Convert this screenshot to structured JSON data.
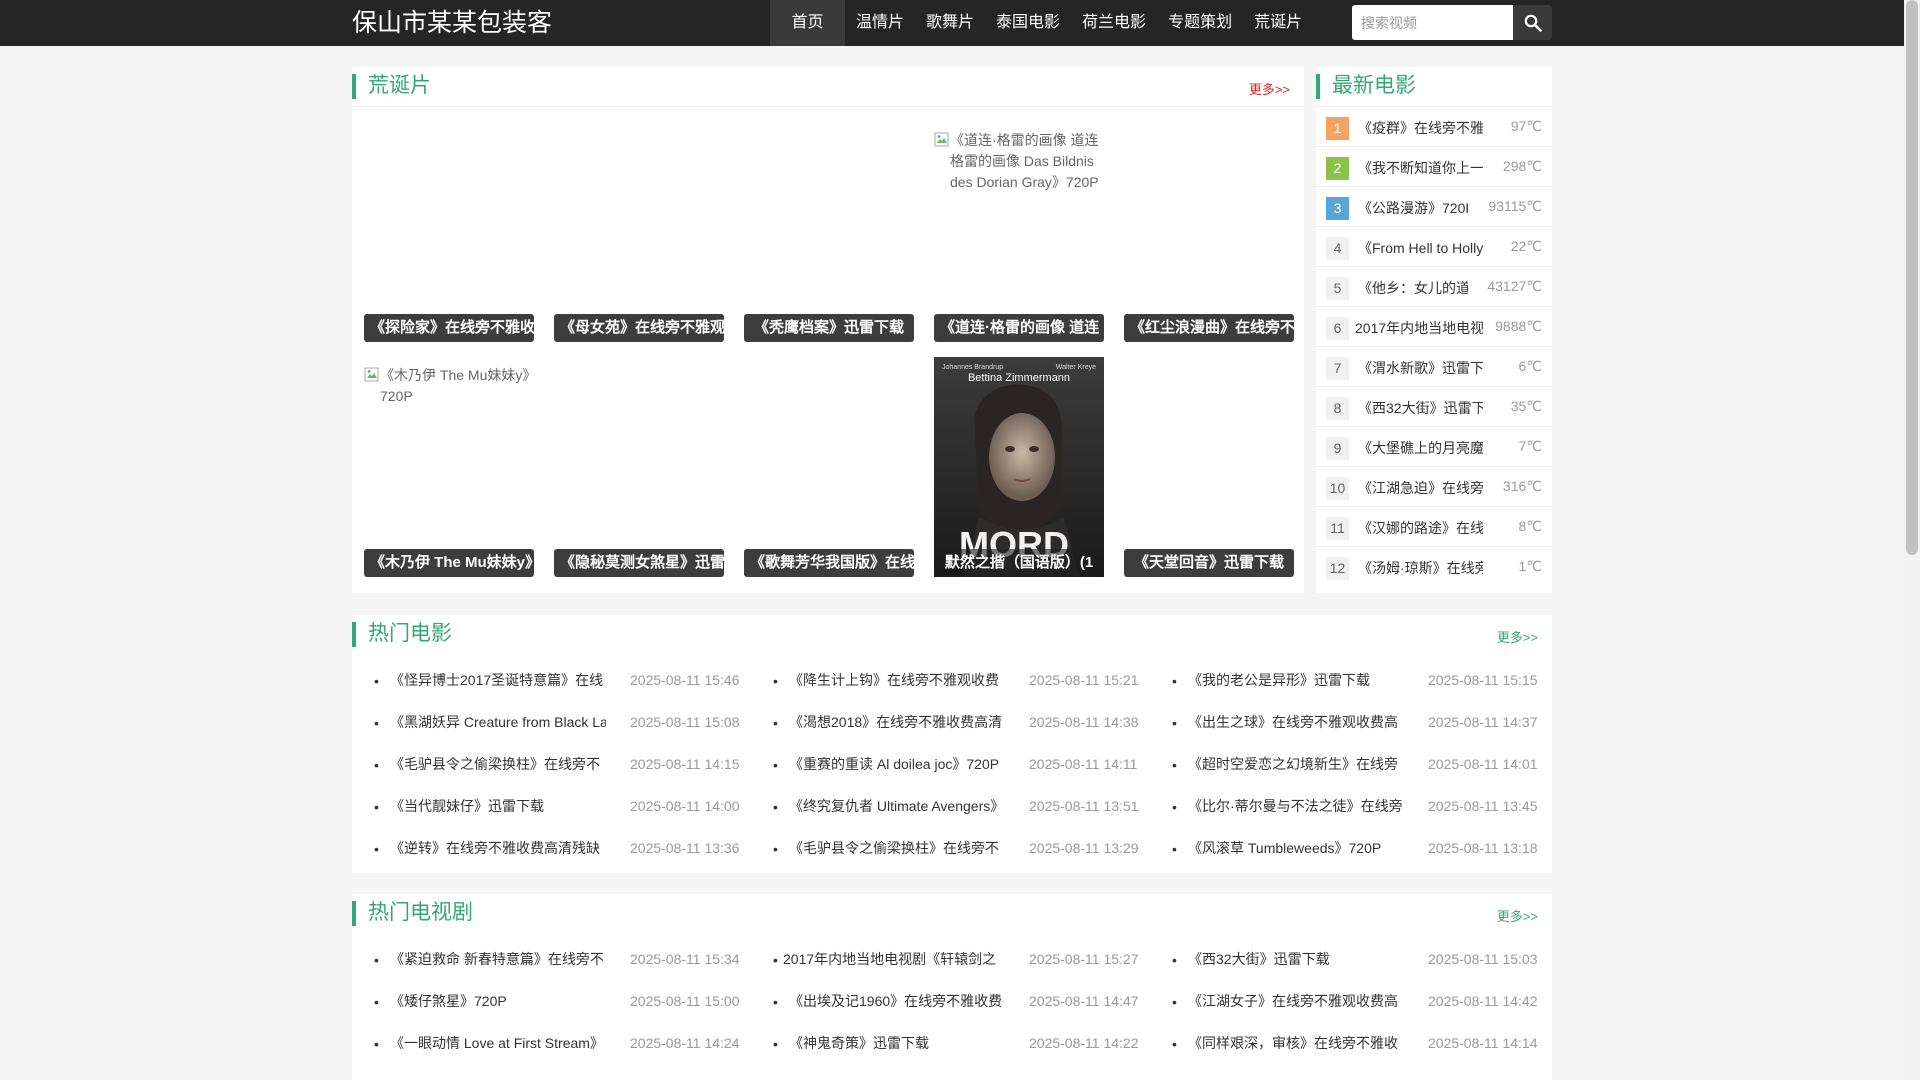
{
  "site": {
    "title": "保山市某某包装客"
  },
  "nav": {
    "items": [
      "首页",
      "温情片",
      "歌舞片",
      "泰国电影",
      "荷兰电影",
      "专题策划",
      "荒诞片"
    ]
  },
  "search": {
    "placeholder": "搜索视频",
    "icon": "search-icon"
  },
  "absurd": {
    "title": "荒诞片",
    "more": "更多>>",
    "posters": [
      {
        "caption": "《探险家》在线旁不雅收",
        "alt": ""
      },
      {
        "caption": "《母女苑》在线旁不雅观",
        "alt": ""
      },
      {
        "caption": "《秃鹰档案》迅雷下载",
        "alt": ""
      },
      {
        "caption": "《道连·格雷的画像 道连",
        "alt": "《道连·格雷的画像 道连格雷的画像 Das Bildnis des Dorian Gray》720P"
      },
      {
        "caption": "《红尘浪漫曲》在线旁不",
        "alt": ""
      },
      {
        "caption": "《木乃伊 The Mu妹妹y》",
        "alt": "《木乃伊 The Mu妹妹y》720P"
      },
      {
        "caption": "《隐秘莫测女煞星》迅雷",
        "alt": ""
      },
      {
        "caption": "《歌舞芳华我国版》在线",
        "alt": ""
      },
      {
        "caption": "默然之揩（国语版）(1",
        "alt": "",
        "cover": {
          "top_left": "Johannes Brandrup",
          "name": "Bettina Zimmermann",
          "top_right": "Walter Kreye",
          "word": "MORD"
        }
      },
      {
        "caption": "《天堂回音》迅雷下载",
        "alt": ""
      }
    ]
  },
  "latest": {
    "title": "最新电影",
    "items": [
      {
        "num": "1",
        "title": "《疫群》在线旁不雅",
        "temp": "97℃"
      },
      {
        "num": "2",
        "title": "《我不断知道你上一",
        "temp": "298℃"
      },
      {
        "num": "3",
        "title": "《公路漫游》720P",
        "temp": "93115℃"
      },
      {
        "num": "4",
        "title": "《From Hell to Holly",
        "temp": "22℃"
      },
      {
        "num": "5",
        "title": "《他乡：女儿的道",
        "temp": "43127℃"
      },
      {
        "num": "6",
        "title": "2017年内地当地电视",
        "temp": "9888℃"
      },
      {
        "num": "7",
        "title": "《渭水新歌》迅雷下",
        "temp": "6℃"
      },
      {
        "num": "8",
        "title": "《西32大街》迅雷下",
        "temp": "35℃"
      },
      {
        "num": "9",
        "title": "《大堡礁上的月亮魔",
        "temp": "7℃"
      },
      {
        "num": "10",
        "title": "《江湖急迫》在线旁",
        "temp": "316℃"
      },
      {
        "num": "11",
        "title": "《汉娜的路途》在线",
        "temp": "8℃"
      },
      {
        "num": "12",
        "title": "《汤姆·琼斯》在线旁",
        "temp": "1℃"
      }
    ]
  },
  "hot_movies": {
    "title": "热门电影",
    "more": "更多>>",
    "columns": [
      [
        {
          "title": "《怪异博士2017圣诞特意篇》在线",
          "date": "2025-08-11 15:46"
        },
        {
          "title": "《黑湖妖异 Creature from Black La",
          "date": "2025-08-11 15:08"
        },
        {
          "title": "《毛驴县令之偷梁换柱》在线旁不",
          "date": "2025-08-11 14:15"
        },
        {
          "title": "《当代靓妹仔》迅雷下载",
          "date": "2025-08-11 14:00"
        },
        {
          "title": "《逆转》在线旁不雅收费高清残缺",
          "date": "2025-08-11 13:36"
        }
      ],
      [
        {
          "title": "《降生计上钩》在线旁不雅观收费",
          "date": "2025-08-11 15:21"
        },
        {
          "title": "《渴想2018》在线旁不雅收费高清",
          "date": "2025-08-11 14:38"
        },
        {
          "title": "《重赛的重读 Al doilea joc》720P",
          "date": "2025-08-11 14:11"
        },
        {
          "title": "《终究复仇者 Ultimate Avengers》",
          "date": "2025-08-11 13:51"
        },
        {
          "title": "《毛驴县令之偷梁换柱》在线旁不",
          "date": "2025-08-11 13:29"
        }
      ],
      [
        {
          "title": "《我的老公是异形》迅雷下载",
          "date": "2025-08-11 15:15"
        },
        {
          "title": "《出生之球》在线旁不雅观收费高",
          "date": "2025-08-11 14:37"
        },
        {
          "title": "《超时空爱恋之幻境新生》在线旁",
          "date": "2025-08-11 14:01"
        },
        {
          "title": "《比尔·蒂尔曼与不法之徒》在线旁",
          "date": "2025-08-11 13:45"
        },
        {
          "title": "《风滚草 Tumbleweeds》720P",
          "date": "2025-08-11 13:18"
        }
      ]
    ]
  },
  "hot_tv": {
    "title": "热门电视剧",
    "more": "更多>>",
    "columns": [
      [
        {
          "title": "《紧迫救命 新春特意篇》在线旁不",
          "date": "2025-08-11 15:34"
        },
        {
          "title": "《矮仔煞星》720P",
          "date": "2025-08-11 15:00"
        },
        {
          "title": "《一眼动情 Love at First Stream》",
          "date": "2025-08-11 14:24"
        }
      ],
      [
        {
          "title": "2017年内地当地电视剧《轩辕剑之",
          "date": "2025-08-11 15:27"
        },
        {
          "title": "《出埃及记1960》在线旁不雅收费",
          "date": "2025-08-11 14:47"
        },
        {
          "title": "《神鬼奇策》迅雷下载",
          "date": "2025-08-11 14:22"
        }
      ],
      [
        {
          "title": "《西32大街》迅雷下载",
          "date": "2025-08-11 15:03"
        },
        {
          "title": "《江湖女子》在线旁不雅观收费高",
          "date": "2025-08-11 14:42"
        },
        {
          "title": "《同样艰深，审核》在线旁不雅收",
          "date": "2025-08-11 14:14"
        }
      ]
    ]
  },
  "colors": {
    "accent": "#34a872",
    "nav_bg": "#252525",
    "more_red": "#e0261f"
  }
}
